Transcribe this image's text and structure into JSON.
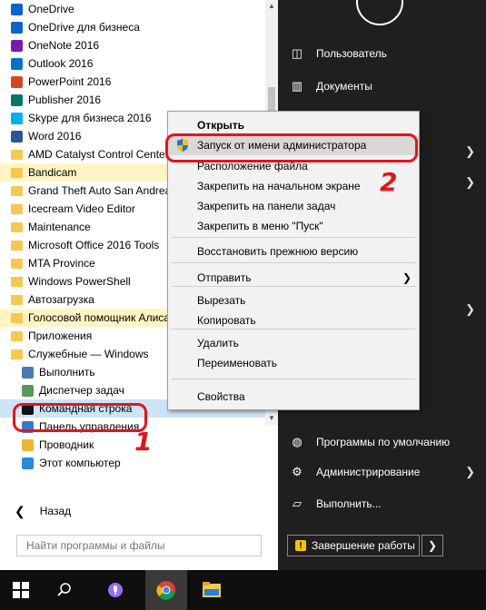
{
  "start_menu": {
    "apps": [
      {
        "label": "OneDrive",
        "type": "app",
        "color": "#0a64c8"
      },
      {
        "label": "OneDrive для бизнеса",
        "type": "app",
        "color": "#0a64c8"
      },
      {
        "label": "OneNote 2016",
        "type": "app",
        "color": "#7719aa"
      },
      {
        "label": "Outlook 2016",
        "type": "app",
        "color": "#0072c6"
      },
      {
        "label": "PowerPoint 2016",
        "type": "app",
        "color": "#d24726"
      },
      {
        "label": "Publisher 2016",
        "type": "app",
        "color": "#077568"
      },
      {
        "label": "Skype для бизнеса 2016",
        "type": "app",
        "color": "#00aff0"
      },
      {
        "label": "Word 2016",
        "type": "app",
        "color": "#2b579a"
      },
      {
        "label": "AMD Catalyst Control Center",
        "type": "folder"
      },
      {
        "label": "Bandicam",
        "type": "folder-hl"
      },
      {
        "label": "Grand Theft Auto San Andreas",
        "type": "folder"
      },
      {
        "label": "Icecream Video Editor",
        "type": "folder"
      },
      {
        "label": "Maintenance",
        "type": "folder"
      },
      {
        "label": "Microsoft Office 2016 Tools",
        "type": "folder"
      },
      {
        "label": "MTA Province",
        "type": "folder"
      },
      {
        "label": "Windows PowerShell",
        "type": "folder"
      },
      {
        "label": "Автозагрузка",
        "type": "folder"
      },
      {
        "label": "Голосовой помощник Алиса",
        "type": "folder-hl"
      },
      {
        "label": "Приложения",
        "type": "folder"
      },
      {
        "label": "Служебные — Windows",
        "type": "folder"
      },
      {
        "label": "Выполнить",
        "type": "sub",
        "color": "#4a7ab0"
      },
      {
        "label": "Диспетчер задач",
        "type": "sub",
        "color": "#5a9a5a"
      },
      {
        "label": "Командная строка",
        "type": "sub-sel",
        "color": "#111111"
      },
      {
        "label": "Панель управления",
        "type": "sub",
        "color": "#3a78c8"
      },
      {
        "label": "Проводник",
        "type": "sub",
        "color": "#e8b830"
      },
      {
        "label": "Этот компьютер",
        "type": "sub",
        "color": "#2a8ad8"
      }
    ],
    "back_label": "Назад",
    "search_placeholder": "Найти программы и файлы"
  },
  "right_panel": {
    "items": [
      {
        "label": "Пользователь",
        "icon": "user-icon",
        "glyph": "◫",
        "chevron": false
      },
      {
        "label": "Документы",
        "icon": "documents-icon",
        "glyph": "▥",
        "chevron": false
      },
      {
        "label": "",
        "icon": "",
        "glyph": "",
        "chevron": true
      },
      {
        "label": "",
        "icon": "",
        "glyph": "",
        "chevron": true
      },
      {
        "label": "",
        "icon": "",
        "glyph": "",
        "chevron": true
      },
      {
        "label": "Программы по умолчанию",
        "icon": "default-programs-icon",
        "glyph": "◍",
        "chevron": false
      },
      {
        "label": "Администрирование",
        "icon": "admin-tools-icon",
        "glyph": "⚙",
        "chevron": true
      },
      {
        "label": "Выполнить...",
        "icon": "run-icon",
        "glyph": "▱",
        "chevron": false
      }
    ],
    "shutdown_label": "Завершение работы"
  },
  "context_menu": {
    "items": [
      {
        "label": "Открыть",
        "bold": true
      },
      {
        "label": "Запуск от имени администратора",
        "shield": true,
        "highlighted": true
      },
      {
        "label": "Расположение файла"
      },
      {
        "label": "Закрепить на начальном экране"
      },
      {
        "label": "Закрепить на панели задач"
      },
      {
        "label": "Закрепить в меню \"Пуск\""
      },
      {
        "label": "Восстановить прежнюю версию"
      },
      {
        "label": "Отправить",
        "submenu": true
      },
      {
        "label": "Вырезать"
      },
      {
        "label": "Копировать"
      },
      {
        "label": "Удалить"
      },
      {
        "label": "Переименовать"
      },
      {
        "label": "Свойства"
      }
    ]
  },
  "annotations": {
    "mark1": "1",
    "mark2": "2",
    "color": "#e5141b"
  }
}
